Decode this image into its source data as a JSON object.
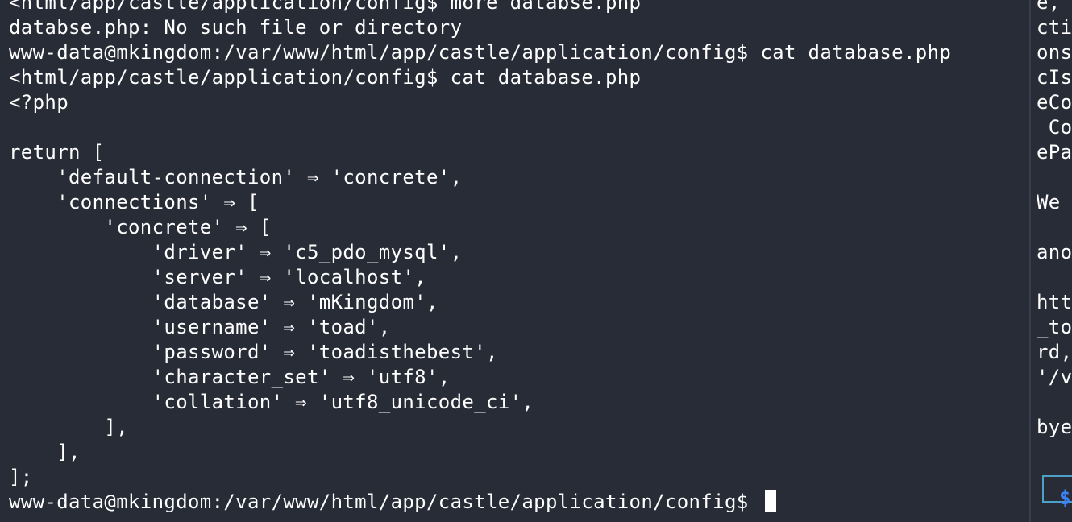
{
  "left_terminal": {
    "lines": [
      "<html/app/castle/application/config$ more databse.php",
      "databse.php: No such file or directory",
      "www-data@mkingdom:/var/www/html/app/castle/application/config$ cat database.php",
      "<html/app/castle/application/config$ cat database.php",
      "<?php",
      "",
      "return [",
      "    'default-connection' ⇒ 'concrete',",
      "    'connections' ⇒ [",
      "        'concrete' ⇒ [",
      "            'driver' ⇒ 'c5_pdo_mysql',",
      "            'server' ⇒ 'localhost',",
      "            'database' ⇒ 'mKingdom',",
      "            'username' ⇒ 'toad',",
      "            'password' ⇒ 'toadisthebest',",
      "            'character_set' ⇒ 'utf8',",
      "            'collation' ⇒ 'utf8_unicode_ci',",
      "        ],",
      "    ],",
      "];"
    ],
    "prompt": "www-data@mkingdom:/var/www/html/app/castle/application/config$ "
  },
  "right_terminal": {
    "lines": [
      "e,",
      "cti",
      "ons",
      "cIs",
      "eCo",
      " Co",
      "ePa",
      "",
      "We ",
      "",
      "ano",
      "",
      "htt",
      "_to",
      "rd,",
      "'/v",
      "",
      "bye",
      "",
      ""
    ],
    "prompt_symbol": "$"
  }
}
